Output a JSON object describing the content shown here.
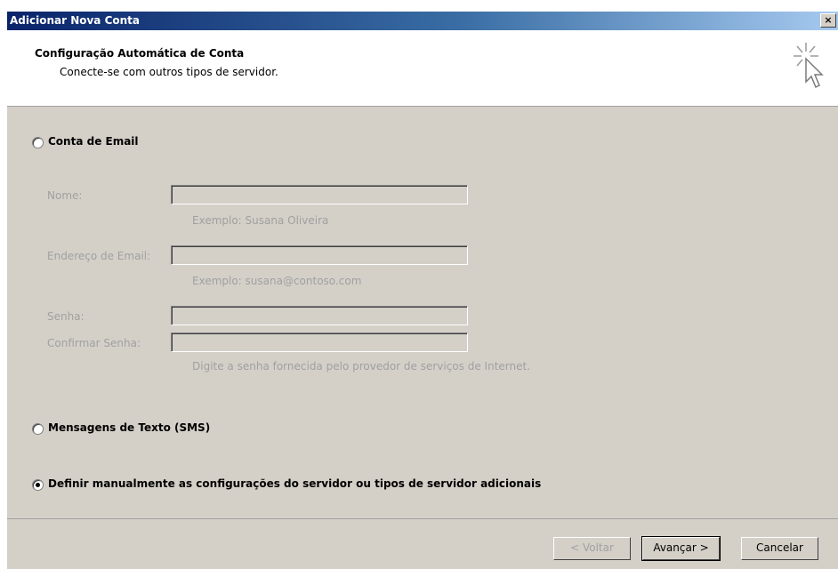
{
  "window": {
    "title": "Adicionar Nova Conta",
    "close_label": "×"
  },
  "header": {
    "title": "Configuração Automática de Conta",
    "subtitle": "Conecte-se com outros tipos de servidor.",
    "icon": "cursor-sparkle-icon"
  },
  "options": {
    "email": {
      "label": "Conta de Email",
      "selected": false
    },
    "sms": {
      "label": "Mensagens de Texto (SMS)",
      "selected": false
    },
    "manual": {
      "label": "Definir manualmente as configurações do servidor ou tipos de servidor adicionais",
      "selected": true
    }
  },
  "fields": {
    "name": {
      "label": "Nome:",
      "value": "",
      "hint": "Exemplo: Susana Oliveira"
    },
    "email": {
      "label": "Endereço de Email:",
      "value": "",
      "hint": "Exemplo: susana@contoso.com"
    },
    "password": {
      "label": "Senha:",
      "value": ""
    },
    "confirm_password": {
      "label": "Confirmar Senha:",
      "value": "",
      "hint": "Digite a senha fornecida pelo provedor de serviços de Internet."
    }
  },
  "buttons": {
    "back": "< Voltar",
    "next": "Avançar >",
    "cancel": "Cancelar"
  }
}
